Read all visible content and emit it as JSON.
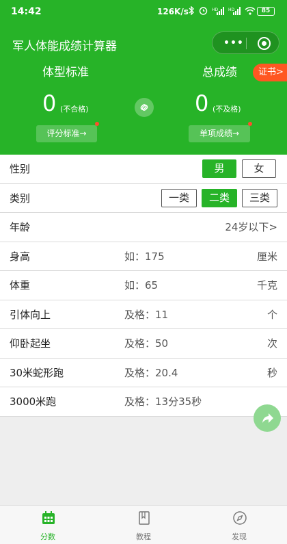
{
  "status_bar": {
    "time": "14:42",
    "network_speed": "126K/s",
    "icons": [
      "bluetooth-icon",
      "alarm-icon",
      "signal-hd-icon",
      "signal-hd-icon",
      "wifi-icon"
    ],
    "battery": "85"
  },
  "header": {
    "app_title": "军人体能成绩计算器",
    "capsule": {
      "menu_icon": "more-dots-icon",
      "close_icon": "target-circle-icon"
    },
    "left": {
      "title": "体型标准",
      "score": "0",
      "note": "(不合格)",
      "button": "评分标准→"
    },
    "right": {
      "title": "总成绩",
      "score": "0",
      "note": "(不及格)",
      "button": "单项成绩→"
    },
    "cert_badge": "证书>",
    "link_icon": "link-icon",
    "accent_color": "#27b328",
    "badge_color": "#ff5722"
  },
  "form": {
    "gender": {
      "label": "性别",
      "options": [
        "男",
        "女"
      ],
      "selected": "男"
    },
    "category": {
      "label": "类别",
      "options": [
        "一类",
        "二类",
        "三类"
      ],
      "selected": "二类"
    },
    "age": {
      "label": "年龄",
      "value": "24岁以下>"
    },
    "height": {
      "label": "身高",
      "placeholder": "如：175",
      "unit": "厘米"
    },
    "weight": {
      "label": "体重",
      "placeholder": "如：65",
      "unit": "千克"
    },
    "pullup": {
      "label": "引体向上",
      "placeholder": "及格：11",
      "unit": "个"
    },
    "situp": {
      "label": "仰卧起坐",
      "placeholder": "及格：50",
      "unit": "次"
    },
    "snake_run": {
      "label": "30米蛇形跑",
      "placeholder": "及格：20.4",
      "unit": "秒"
    },
    "run3000": {
      "label": "3000米跑",
      "placeholder": "及格：13分35秒",
      "unit": ""
    }
  },
  "share_button_icon": "share-arrow-icon",
  "tabbar": {
    "tabs": [
      {
        "label": "分数",
        "icon": "calendar-icon",
        "active": true
      },
      {
        "label": "教程",
        "icon": "book-icon",
        "active": false
      },
      {
        "label": "发现",
        "icon": "compass-icon",
        "active": false
      }
    ]
  }
}
